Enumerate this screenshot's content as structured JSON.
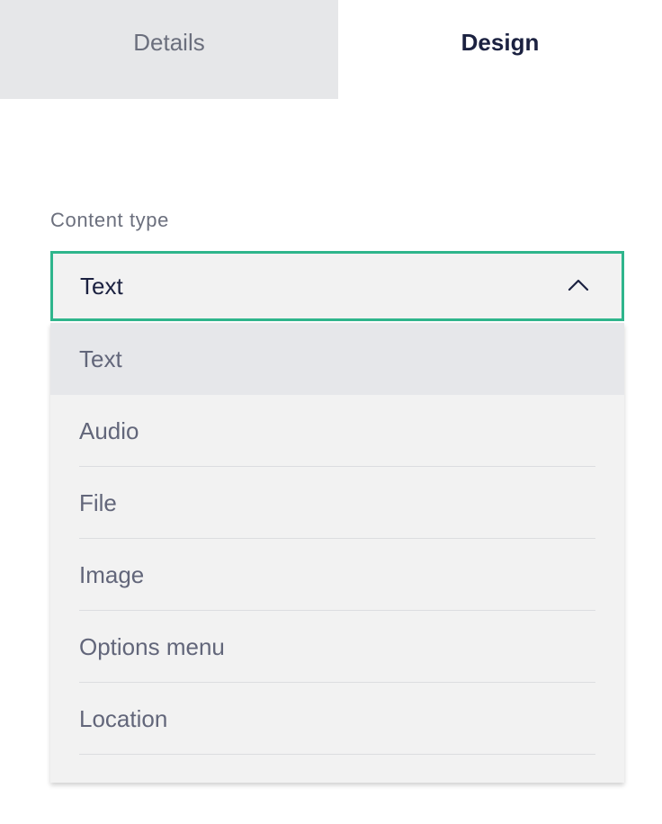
{
  "tabs": [
    {
      "label": "Details",
      "active": false
    },
    {
      "label": "Design",
      "active": true
    }
  ],
  "content_type": {
    "label": "Content type",
    "selected_value": "Text",
    "expanded": true,
    "chevron_icon": "chevron-up-icon",
    "options": [
      {
        "label": "Text",
        "selected": true
      },
      {
        "label": "Audio",
        "selected": false
      },
      {
        "label": "File",
        "selected": false
      },
      {
        "label": "Image",
        "selected": false
      },
      {
        "label": "Options menu",
        "selected": false
      },
      {
        "label": "Location",
        "selected": false
      }
    ]
  },
  "colors": {
    "focus_border": "#2fb58c",
    "tab_inactive_bg": "#e6e7e9",
    "text_dark": "#1b2140",
    "text_muted": "#6b6f7d",
    "field_bg": "#f2f2f2"
  }
}
